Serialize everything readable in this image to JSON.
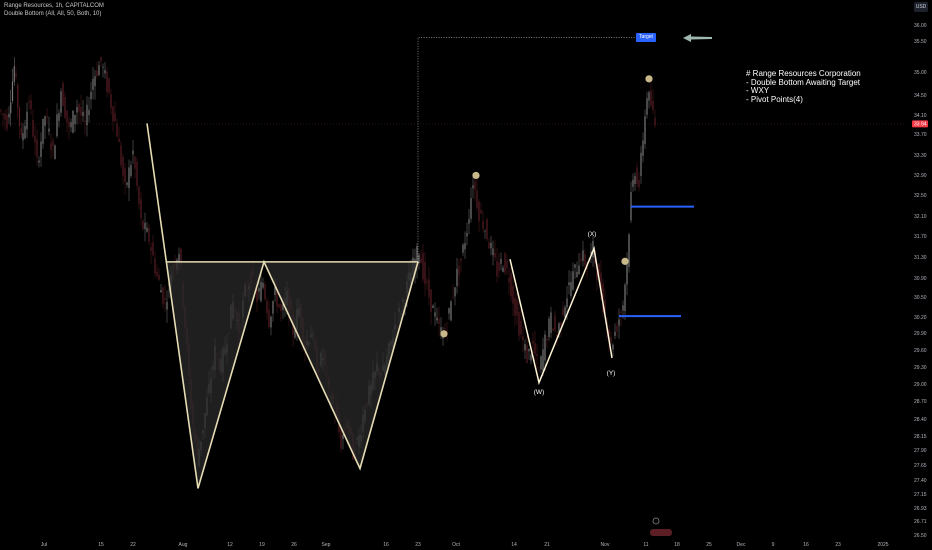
{
  "header": {
    "title": "Range Resources, 1h, CAPITALCOM",
    "indicator": "Double Bottom (All, All, 50, Both, 10)"
  },
  "currency": "USD",
  "notes": {
    "title": "# Range Resources Corporation",
    "lines": [
      "- Double Bottom Awaiting Target",
      "- WXY",
      "- Pivot Points(4)"
    ]
  },
  "target_label": "Target",
  "colors": {
    "background": "#000000",
    "pattern_line": "#e6dcb4",
    "pattern_fill": "#2a2a2a",
    "pivot_dot": "#c9b98a",
    "level_line": "#2962ff",
    "target_box": "#2962ff",
    "candle_up": "#7a7a7a",
    "candle_down": "#5a1e24",
    "wxy_line": "#fff5d6",
    "arrow": "#9fb8b0",
    "last_price_bg": "#f23645"
  },
  "chart_data": {
    "type": "candlestick",
    "title": "Range Resources, 1h, CAPITALCOM",
    "ylim": [
      26.3,
      36.1
    ],
    "y_scale": "linear",
    "y_ticks": [
      "36.00",
      "35.50",
      "35.00",
      "34.50",
      "34.10",
      "33.70",
      "33.30",
      "32.90",
      "32.50",
      "32.10",
      "31.70",
      "31.30",
      "30.90",
      "30.50",
      "30.20",
      "29.90",
      "29.60",
      "29.30",
      "29.00",
      "28.70",
      "28.40",
      "28.15",
      "27.90",
      "27.65",
      "27.40",
      "27.15",
      "26.93",
      "26.71",
      "26.50"
    ],
    "x_ticks": [
      "Jul",
      "15",
      "22",
      "Aug",
      "12",
      "19",
      "26",
      "Sep",
      "16",
      "23",
      "Oct",
      "14",
      "21",
      "Nov",
      "11",
      "18",
      "25",
      "Dec",
      "9",
      "16",
      "23",
      "2025"
    ],
    "last_price": "33.94",
    "target_price": 35.55,
    "double_bottom": {
      "neckline": 31.37,
      "points": [
        {
          "label": "start",
          "price": 33.95
        },
        {
          "label": "bottom-1",
          "price": 27.15
        },
        {
          "label": "peak",
          "price": 31.37
        },
        {
          "label": "bottom-2",
          "price": 27.52
        },
        {
          "label": "breakout",
          "price": 31.37
        }
      ]
    },
    "wxy": [
      {
        "label": "",
        "price": 31.42
      },
      {
        "label": "(W)",
        "price": 29.12
      },
      {
        "label": "(X)",
        "price": 31.62
      },
      {
        "label": "(Y)",
        "price": 29.58
      }
    ],
    "pivot_points": [
      30.03,
      32.98,
      31.38,
      34.78
    ],
    "horizontal_levels": [
      {
        "price": 32.4
      },
      {
        "price": 30.36
      }
    ],
    "price_path": [
      [
        0,
        34.2
      ],
      [
        8,
        34.0
      ],
      [
        15,
        35.0
      ],
      [
        22,
        33.6
      ],
      [
        30,
        34.4
      ],
      [
        38,
        33.2
      ],
      [
        46,
        34.1
      ],
      [
        54,
        33.4
      ],
      [
        62,
        34.6
      ],
      [
        70,
        33.8
      ],
      [
        78,
        34.3
      ],
      [
        86,
        33.9
      ],
      [
        94,
        34.8
      ],
      [
        102,
        35.1
      ],
      [
        110,
        34.5
      ],
      [
        118,
        33.8
      ],
      [
        126,
        32.7
      ],
      [
        134,
        33.4
      ],
      [
        142,
        32.1
      ],
      [
        150,
        31.8
      ],
      [
        158,
        31.1
      ],
      [
        166,
        30.6
      ],
      [
        172,
        31.2
      ],
      [
        180,
        31.6
      ],
      [
        186,
        30.2
      ],
      [
        192,
        28.7
      ],
      [
        198,
        27.7
      ],
      [
        204,
        28.3
      ],
      [
        210,
        29.0
      ],
      [
        216,
        29.7
      ],
      [
        222,
        29.4
      ],
      [
        228,
        30.0
      ],
      [
        234,
        30.6
      ],
      [
        240,
        30.1
      ],
      [
        246,
        30.8
      ],
      [
        252,
        31.1
      ],
      [
        258,
        30.7
      ],
      [
        264,
        31.0
      ],
      [
        270,
        30.3
      ],
      [
        276,
        30.8
      ],
      [
        282,
        30.4
      ],
      [
        288,
        30.7
      ],
      [
        294,
        30.1
      ],
      [
        300,
        30.5
      ],
      [
        306,
        29.8
      ],
      [
        312,
        30.1
      ],
      [
        318,
        29.4
      ],
      [
        324,
        29.6
      ],
      [
        330,
        28.9
      ],
      [
        336,
        28.6
      ],
      [
        342,
        28.0
      ],
      [
        348,
        28.4
      ],
      [
        354,
        27.8
      ],
      [
        360,
        28.1
      ],
      [
        366,
        28.7
      ],
      [
        372,
        29.0
      ],
      [
        378,
        29.4
      ],
      [
        384,
        29.3
      ],
      [
        390,
        29.7
      ],
      [
        396,
        30.2
      ],
      [
        402,
        30.5
      ],
      [
        408,
        30.9
      ],
      [
        414,
        31.3
      ],
      [
        420,
        31.6
      ],
      [
        426,
        31.0
      ],
      [
        432,
        30.6
      ],
      [
        438,
        30.2
      ],
      [
        444,
        30.0
      ],
      [
        450,
        30.4
      ],
      [
        456,
        31.0
      ],
      [
        462,
        31.4
      ],
      [
        468,
        32.0
      ],
      [
        474,
        32.9
      ],
      [
        480,
        32.3
      ],
      [
        486,
        32.0
      ],
      [
        492,
        31.6
      ],
      [
        498,
        31.2
      ],
      [
        504,
        31.4
      ],
      [
        510,
        31.1
      ],
      [
        516,
        30.5
      ],
      [
        522,
        30.0
      ],
      [
        528,
        29.6
      ],
      [
        534,
        29.8
      ],
      [
        540,
        29.3
      ],
      [
        546,
        29.9
      ],
      [
        552,
        30.3
      ],
      [
        558,
        30.0
      ],
      [
        564,
        30.5
      ],
      [
        570,
        30.9
      ],
      [
        576,
        31.2
      ],
      [
        582,
        31.5
      ],
      [
        588,
        31.3
      ],
      [
        594,
        31.6
      ],
      [
        600,
        31.0
      ],
      [
        606,
        30.4
      ],
      [
        612,
        29.8
      ],
      [
        618,
        30.2
      ],
      [
        624,
        30.6
      ],
      [
        628,
        31.4
      ],
      [
        632,
        32.6
      ],
      [
        636,
        33.1
      ],
      [
        640,
        32.8
      ],
      [
        644,
        33.7
      ],
      [
        648,
        34.5
      ],
      [
        652,
        34.3
      ],
      [
        656,
        33.9
      ]
    ]
  }
}
